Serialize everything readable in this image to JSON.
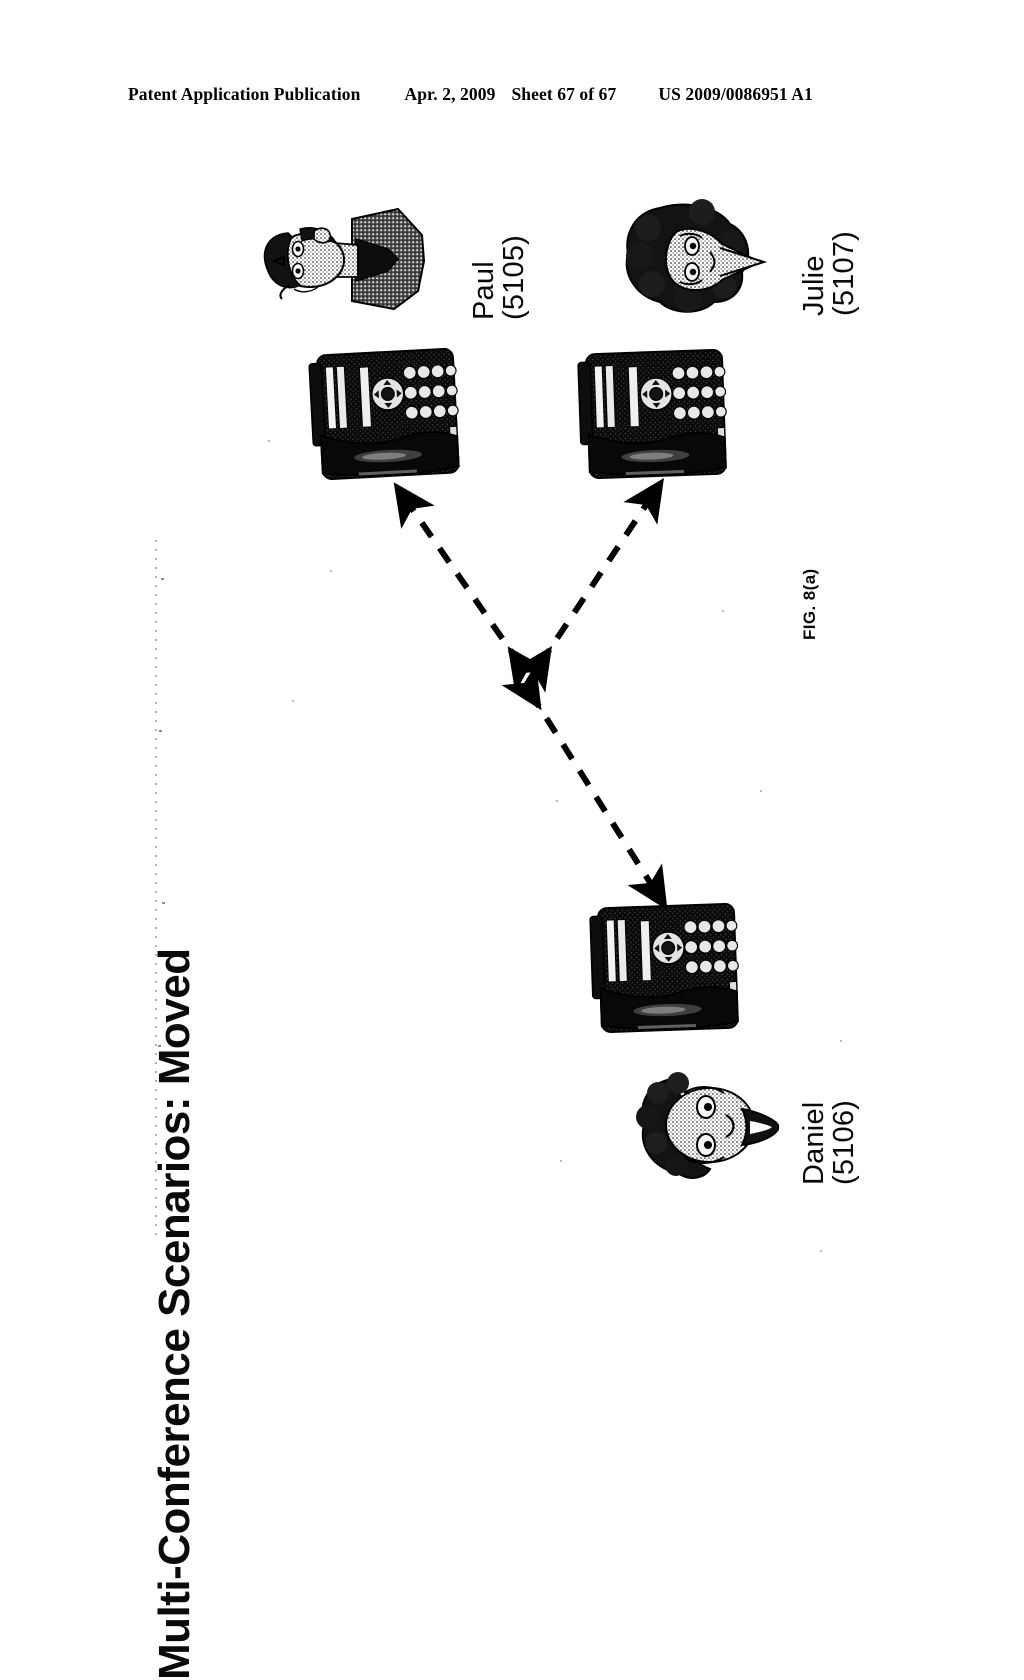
{
  "header": {
    "publication": "Patent Application Publication",
    "date": "Apr. 2, 2009",
    "sheet": "Sheet 67 of 67",
    "patent_number": "US 2009/0086951 A1"
  },
  "figure": {
    "title": "Multi-Conference Scenarios: Moved",
    "caption": "FIG. 8(a)",
    "ink_color": "#000000",
    "background_color": "#ffffff",
    "participants": [
      {
        "id": "paul",
        "name": "Paul",
        "reference": "(5105)",
        "avatar_icon": "person-bust-icon",
        "device_icon": "desk-phone-icon"
      },
      {
        "id": "julie",
        "name": "Julie",
        "reference": "(5107)",
        "avatar_icon": "person-head-icon",
        "device_icon": "desk-phone-icon"
      },
      {
        "id": "daniel",
        "name": "Daniel",
        "reference": "(5106)",
        "avatar_icon": "person-head-icon",
        "device_icon": "desk-phone-icon"
      }
    ],
    "connections": [
      {
        "from": "center",
        "to": "paul-phone",
        "style": "dashed",
        "heads": "both"
      },
      {
        "from": "center",
        "to": "julie-phone",
        "style": "dashed",
        "heads": "both"
      },
      {
        "from": "center",
        "to": "daniel-phone",
        "style": "dashed",
        "heads": "both"
      }
    ]
  }
}
